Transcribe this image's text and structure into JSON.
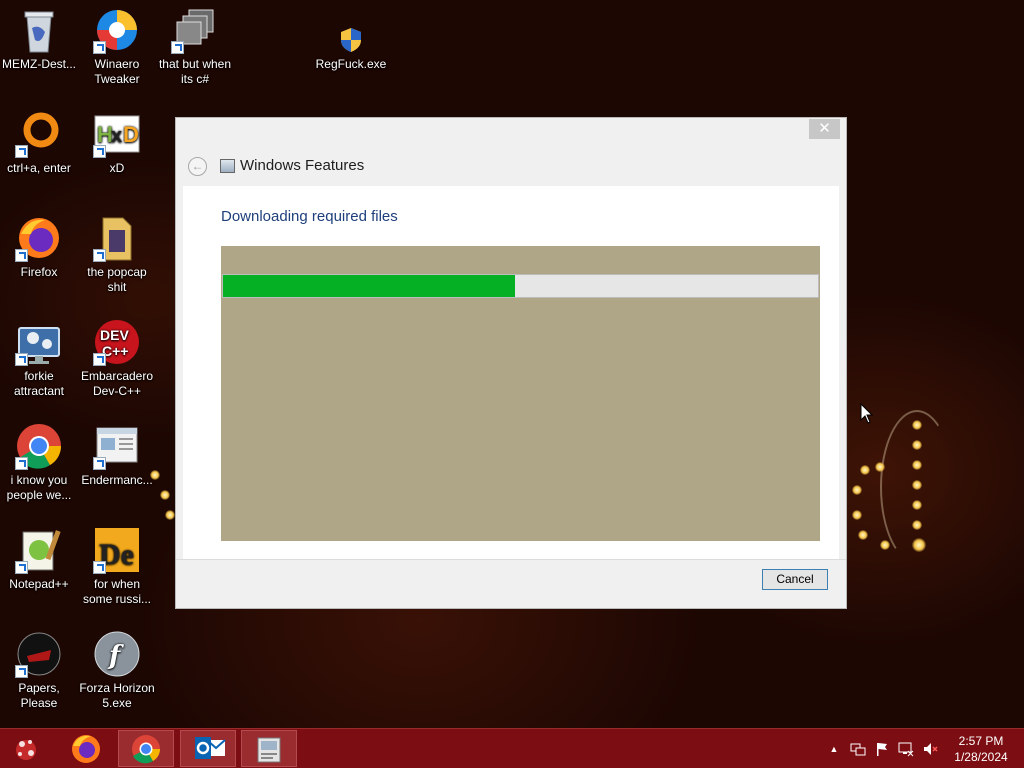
{
  "desktop_icons": [
    {
      "label": "MEMZ-Dest...",
      "icon": "recycle-bin-icon"
    },
    {
      "label": "Winaero Tweaker",
      "icon": "winaero-icon"
    },
    {
      "label": "that but when its c#",
      "icon": "windows-stack-icon"
    },
    {
      "label": "RegFuck.exe",
      "icon": "uac-shield-icon"
    },
    {
      "label": "ctrl+a, enter",
      "icon": "orange-ring-icon"
    },
    {
      "label": "xD",
      "icon": "hxd-icon"
    },
    {
      "label": "Firefox",
      "icon": "firefox-icon"
    },
    {
      "label": "the popcap shit",
      "icon": "folder-icon"
    },
    {
      "label": "forkie attractant",
      "icon": "monitor-gears-icon"
    },
    {
      "label": "Embarcadero Dev-C++",
      "icon": "devcpp-icon"
    },
    {
      "label": "i know you people we...",
      "icon": "chrome-icon"
    },
    {
      "label": "Endermanc...",
      "icon": "document-window-icon"
    },
    {
      "label": "Notepad++",
      "icon": "notepadpp-icon"
    },
    {
      "label": "for when some russi...",
      "icon": "de-icon"
    },
    {
      "label": "Papers, Please",
      "icon": "papers-please-icon"
    },
    {
      "label": "Forza Horizon 5.exe",
      "icon": "flash-icon"
    }
  ],
  "dialog": {
    "title": "Windows Features",
    "close_label": "✕",
    "back_label": "←",
    "heading": "Downloading required files",
    "progress": 0.49,
    "cancel_label": "Cancel"
  },
  "taskbar": {
    "items": [
      "start-icon",
      "firefox-icon",
      "chrome-icon",
      "outlook-icon",
      "windows-features-icon"
    ],
    "tray_arrow": "▲",
    "time": "2:57 PM",
    "date": "1/28/2024"
  },
  "colors": {
    "taskbar": "#7c0d12",
    "progress_fill": "#06b025",
    "heading": "#1e3f7c"
  }
}
